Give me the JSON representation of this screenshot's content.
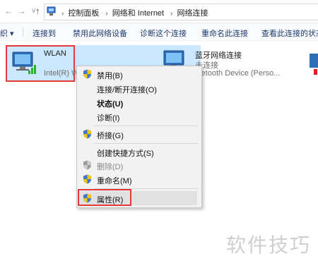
{
  "address": {
    "crumbs": [
      "控制面板",
      "网络和 Internet",
      "网络连接"
    ]
  },
  "toolbar": {
    "cut_prefix": "织 ▾",
    "connect": "连接到",
    "disable": "禁用此网络设备",
    "diagnose": "诊断这个连接",
    "rename": "重命名此连接",
    "status": "查看此连接的状态"
  },
  "items": [
    {
      "name": "WLAN",
      "detail": "Intel(R) W"
    },
    {
      "name": "蓝牙网络连接",
      "status": "未连接",
      "detail": "luetooth Device (Perso..."
    }
  ],
  "context_menu": [
    {
      "label": "禁用(B)",
      "shield": true
    },
    {
      "label": "连接/断开连接(O)"
    },
    {
      "label": "状态(U)",
      "bold": true
    },
    {
      "label": "诊断(I)"
    },
    {
      "label": "桥接(G)",
      "shield": true
    },
    {
      "label": "创建快捷方式(S)"
    },
    {
      "label": "删除(D)",
      "shield": true,
      "disabled": true
    },
    {
      "label": "重命名(M)",
      "shield": true
    },
    {
      "label": "属性(R)",
      "shield": true,
      "highlighted": true
    }
  ],
  "watermark": "软件技巧",
  "colors": {
    "selection": "#cce8ff",
    "highlight_box": "#e23b3b",
    "link": "#1e3a6e"
  }
}
